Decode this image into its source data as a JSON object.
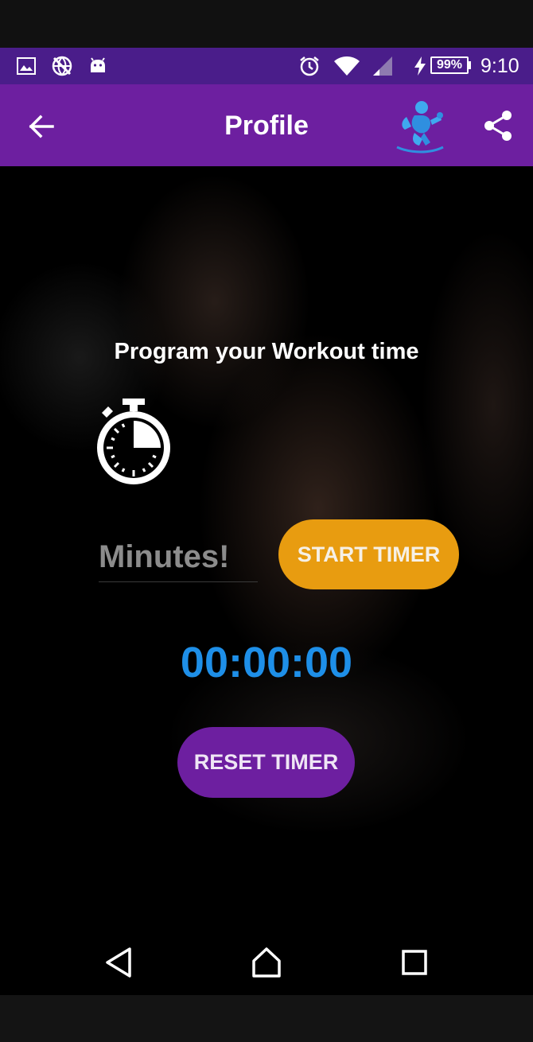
{
  "status_bar": {
    "battery": "99%",
    "time": "9:10",
    "icons": [
      "gallery-icon",
      "no-web-icon",
      "android-icon",
      "alarm-icon",
      "wifi-icon",
      "signal-icon",
      "charging-icon",
      "battery-icon"
    ]
  },
  "app_bar": {
    "title": "Profile",
    "back_icon": "arrow-left-icon",
    "logo_icon": "fitness-logo-icon",
    "share_icon": "share-icon"
  },
  "main": {
    "headline": "Program your Workout time",
    "stopwatch_icon": "stopwatch-icon",
    "minutes_placeholder": "Minutes!",
    "start_button": "START TIMER",
    "timer_value": "00:00:00",
    "reset_button": "RESET TIMER"
  },
  "nav_bar": {
    "back": "nav-back-icon",
    "home": "nav-home-icon",
    "recents": "nav-recents-icon"
  },
  "colors": {
    "status_bar": "#4a1d8a",
    "app_bar": "#6d1fa0",
    "start_button": "#e89c10",
    "reset_button": "#6d1fa0",
    "timer_text": "#1e8fe8"
  }
}
